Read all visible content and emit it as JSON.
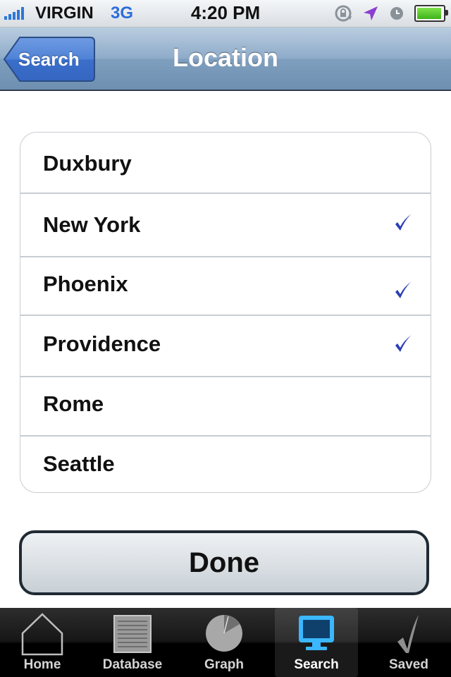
{
  "status_bar": {
    "carrier": "VIRGIN",
    "network": "3G",
    "time": "4:20 PM"
  },
  "nav": {
    "back_label": "Search",
    "title": "Location"
  },
  "locations": [
    {
      "name": "Duxbury",
      "checked": false
    },
    {
      "name": "New York",
      "checked": true
    },
    {
      "name": "Phoenix",
      "checked": true
    },
    {
      "name": "Providence",
      "checked": true
    },
    {
      "name": "Rome",
      "checked": false
    },
    {
      "name": "Seattle",
      "checked": false
    }
  ],
  "done_label": "Done",
  "tabs": [
    {
      "label": "Home",
      "icon": "home-icon",
      "active": false
    },
    {
      "label": "Database",
      "icon": "database-icon",
      "active": false
    },
    {
      "label": "Graph",
      "icon": "graph-icon",
      "active": false
    },
    {
      "label": "Search",
      "icon": "search-monitor-icon",
      "active": true
    },
    {
      "label": "Saved",
      "icon": "checkmark-saved-icon",
      "active": false
    }
  ],
  "colors": {
    "accent": "#2d6ddb",
    "check": "#2a3fb5",
    "nav_bar": "#8eabc9",
    "tab_bar": "#111111"
  }
}
